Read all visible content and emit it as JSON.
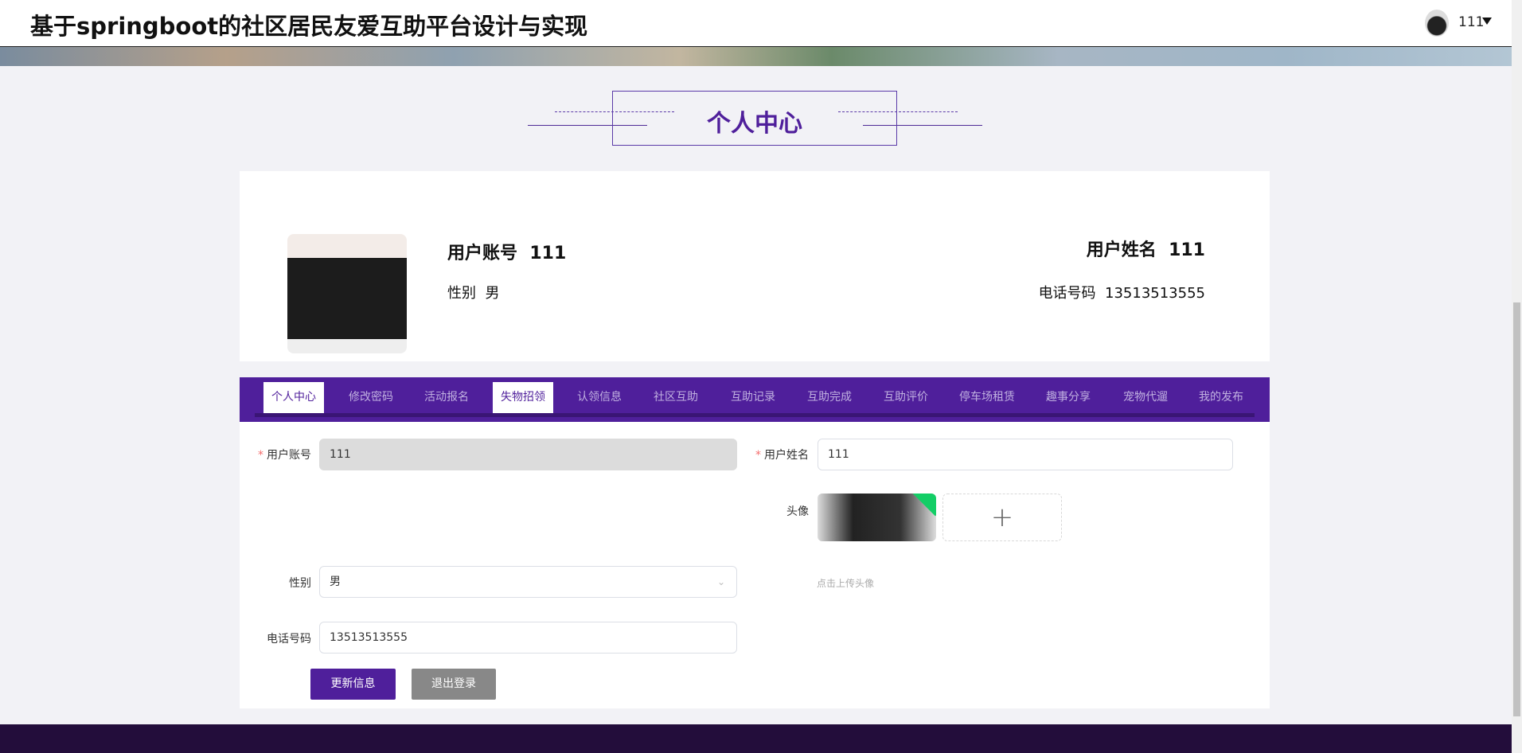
{
  "header": {
    "title": "基于springboot的社区居民友爱互助平台设计与实现",
    "user": "111"
  },
  "page_heading": "个人中心",
  "profile": {
    "account_label": "用户账号",
    "account": "111",
    "name_label": "用户姓名",
    "name": "111",
    "gender_label": "性别",
    "gender": "男",
    "phone_label": "电话号码",
    "phone": "13513513555"
  },
  "tabs": [
    {
      "label": "个人中心",
      "active": true
    },
    {
      "label": "修改密码"
    },
    {
      "label": "活动报名"
    },
    {
      "label": "失物招领",
      "hover": true
    },
    {
      "label": "认领信息"
    },
    {
      "label": "社区互助"
    },
    {
      "label": "互助记录"
    },
    {
      "label": "互助完成"
    },
    {
      "label": "互助评价"
    },
    {
      "label": "停车场租赁"
    },
    {
      "label": "趣事分享"
    },
    {
      "label": "宠物代遛"
    },
    {
      "label": "我的发布"
    }
  ],
  "form": {
    "account_label": "用户账号",
    "account": "111",
    "name_label": "用户姓名",
    "name": "111",
    "avatar_label": "头像",
    "avatar_hint": "点击上传头像",
    "gender_label": "性别",
    "gender": "男",
    "phone_label": "电话号码",
    "phone": "13513513555",
    "update_button": "更新信息",
    "logout_button": "退出登录"
  },
  "colors": {
    "primary": "#4f1f9b",
    "footer": "#230d3b"
  }
}
